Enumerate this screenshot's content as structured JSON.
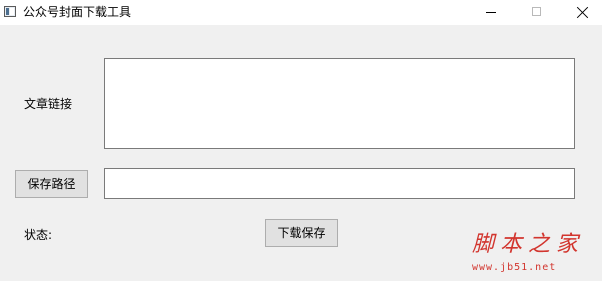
{
  "window": {
    "title": "公众号封面下载工具",
    "controls": {
      "minimize": "minimize-icon",
      "maximize": "maximize-icon",
      "close": "close-icon"
    }
  },
  "form": {
    "article_link_label": "文章链接",
    "article_link_value": "",
    "save_path_button": "保存路径",
    "save_path_value": "",
    "status_label": "状态:",
    "download_button": "下载保存"
  },
  "watermark": {
    "title": "脚本之家",
    "url": "www.jb51.net"
  },
  "colors": {
    "window_bg": "#f0f0f0",
    "titlebar_bg": "#ffffff",
    "button_bg": "#e1e1e1",
    "watermark": "#d2352e"
  }
}
